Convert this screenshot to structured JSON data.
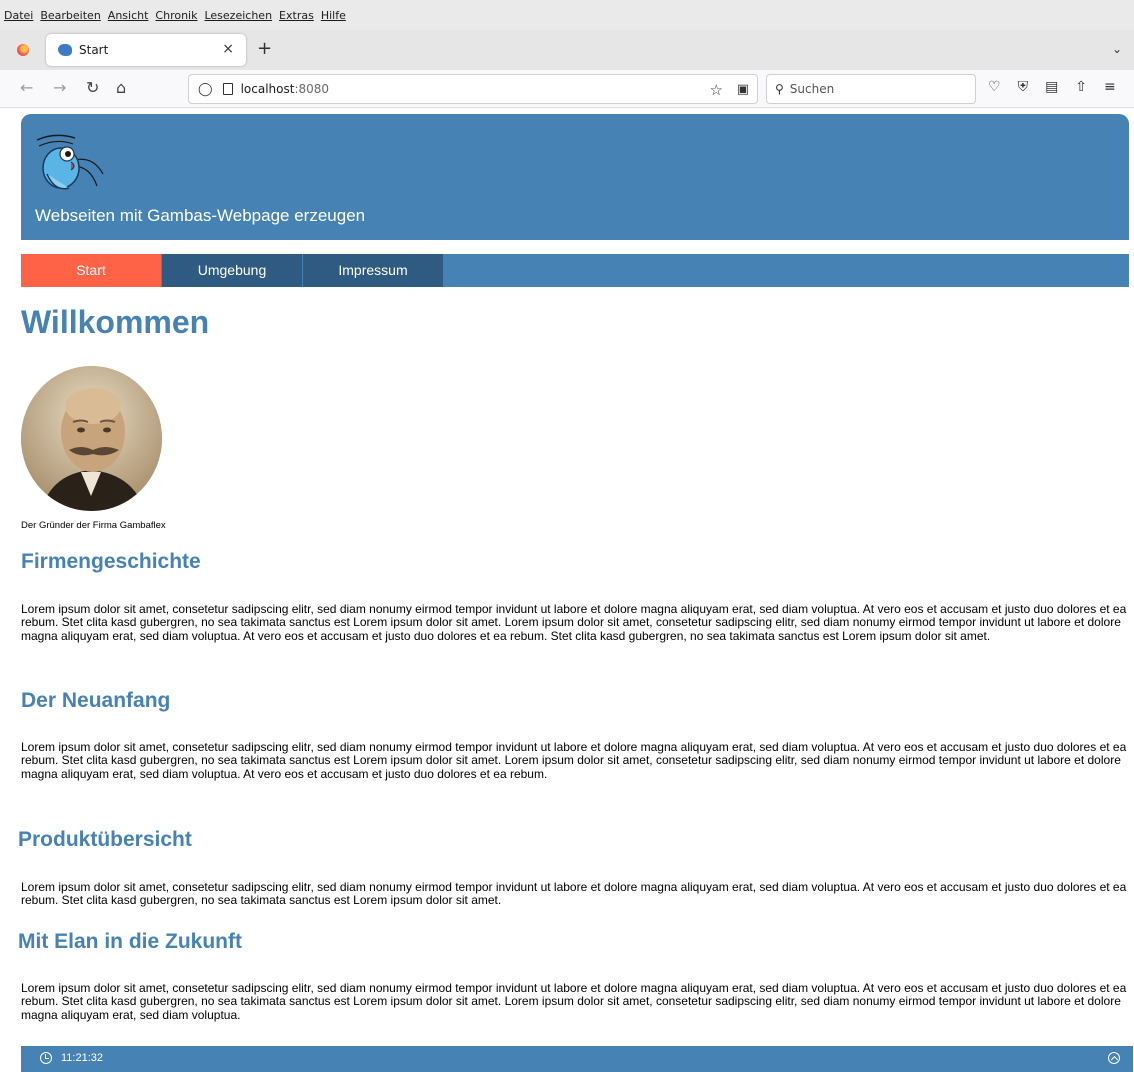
{
  "browser": {
    "menu": [
      "Datei",
      "Bearbeiten",
      "Ansicht",
      "Chronik",
      "Lesezeichen",
      "Extras",
      "Hilfe"
    ],
    "tab_title": "Start",
    "url_host": "localhost",
    "url_port": ":8080",
    "search_placeholder": "Suchen"
  },
  "site": {
    "header_title": "Webseiten mit Gambas-Webpage erzeugen",
    "nav": [
      {
        "label": "Start",
        "active": true
      },
      {
        "label": "Umgebung",
        "active": false
      },
      {
        "label": "Impressum",
        "active": false
      }
    ]
  },
  "main": {
    "title": "Willkommen",
    "caption": "Der Gründer der Firma Gambaflex",
    "sections": [
      {
        "heading": "Firmengeschichte",
        "text": "Lorem ipsum dolor sit amet, consetetur sadipscing elitr, sed diam nonumy eirmod tempor invidunt ut labore et dolore magna aliquyam erat, sed diam voluptua. At vero eos et accusam et justo duo dolores et ea rebum. Stet clita kasd gubergren, no sea takimata sanctus est Lorem ipsum dolor sit amet. Lorem ipsum dolor sit amet, consetetur sadipscing elitr, sed diam nonumy eirmod tempor invidunt ut labore et dolore magna aliquyam erat, sed diam voluptua. At vero eos et accusam et justo duo dolores et ea rebum. Stet clita kasd gubergren, no sea takimata sanctus est Lorem ipsum dolor sit amet."
      },
      {
        "heading": "Der Neuanfang",
        "text": "Lorem ipsum dolor sit amet, consetetur sadipscing elitr, sed diam nonumy eirmod tempor invidunt ut labore et dolore magna aliquyam erat, sed diam voluptua. At vero eos et accusam et justo duo dolores et ea rebum. Stet clita kasd gubergren, no sea takimata sanctus est Lorem ipsum dolor sit amet. Lorem ipsum dolor sit amet, consetetur sadipscing elitr, sed diam nonumy eirmod tempor invidunt ut labore et dolore magna aliquyam erat, sed diam voluptua. At vero eos et accusam et justo duo dolores et ea rebum."
      },
      {
        "heading": "Produktübersicht",
        "text": "Lorem ipsum dolor sit amet, consetetur sadipscing elitr, sed diam nonumy eirmod tempor invidunt ut labore et dolore magna aliquyam erat, sed diam voluptua. At vero eos et accusam et justo duo dolores et ea rebum. Stet clita kasd gubergren, no sea takimata sanctus est Lorem ipsum dolor sit amet."
      },
      {
        "heading": "Mit Elan in die Zukunft",
        "text": "Lorem ipsum dolor sit amet, consetetur sadipscing elitr, sed diam nonumy eirmod tempor invidunt ut labore et dolore magna aliquyam erat, sed diam voluptua. At vero eos et accusam et justo duo dolores et ea rebum. Stet clita kasd gubergren, no sea takimata sanctus est Lorem ipsum dolor sit amet. Lorem ipsum dolor sit amet, consetetur sadipscing elitr, sed diam nonumy eirmod tempor invidunt ut labore et dolore magna aliquyam erat, sed diam voluptua."
      }
    ]
  },
  "footer": {
    "time": "11:21:32"
  },
  "colors": {
    "brand": "#4682b4",
    "nav_inactive": "#2f5b82",
    "nav_active": "#ff6347"
  },
  "icons": [
    "firefox-icon",
    "gambas-logo-icon",
    "clock-icon",
    "scroll-top-icon"
  ]
}
